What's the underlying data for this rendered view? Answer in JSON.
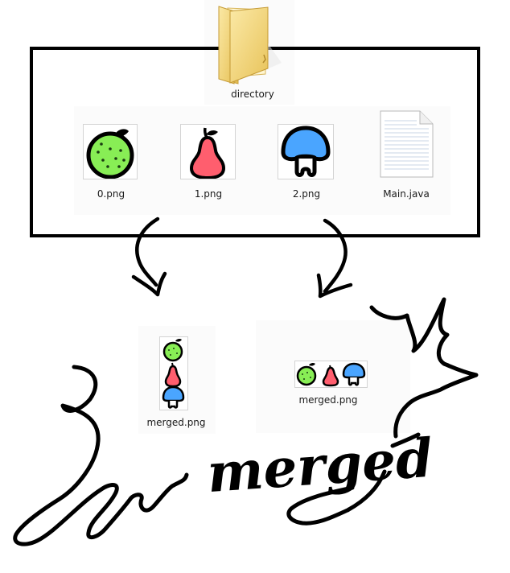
{
  "folder": {
    "label": "directory",
    "icon": "folder-icon"
  },
  "files": [
    {
      "label": "0.png",
      "icon": "orange-icon",
      "color": "#88ee55"
    },
    {
      "label": "1.png",
      "icon": "pear-icon",
      "color": "#ff5e6e"
    },
    {
      "label": "2.png",
      "icon": "mushroom-icon",
      "color": "#4aa5ff"
    },
    {
      "label": "Main.java",
      "icon": "java-file-icon"
    }
  ],
  "results": {
    "vertical": {
      "label": "merged.png",
      "icon": "merged-vertical-image-icon"
    },
    "horizontal": {
      "label": "merged.png",
      "icon": "merged-horizontal-image-icon"
    }
  },
  "handwriting": {
    "text": "merged"
  },
  "colors": {
    "frame": "#000000",
    "folder": "#f5d77a",
    "outline": "#000000"
  }
}
